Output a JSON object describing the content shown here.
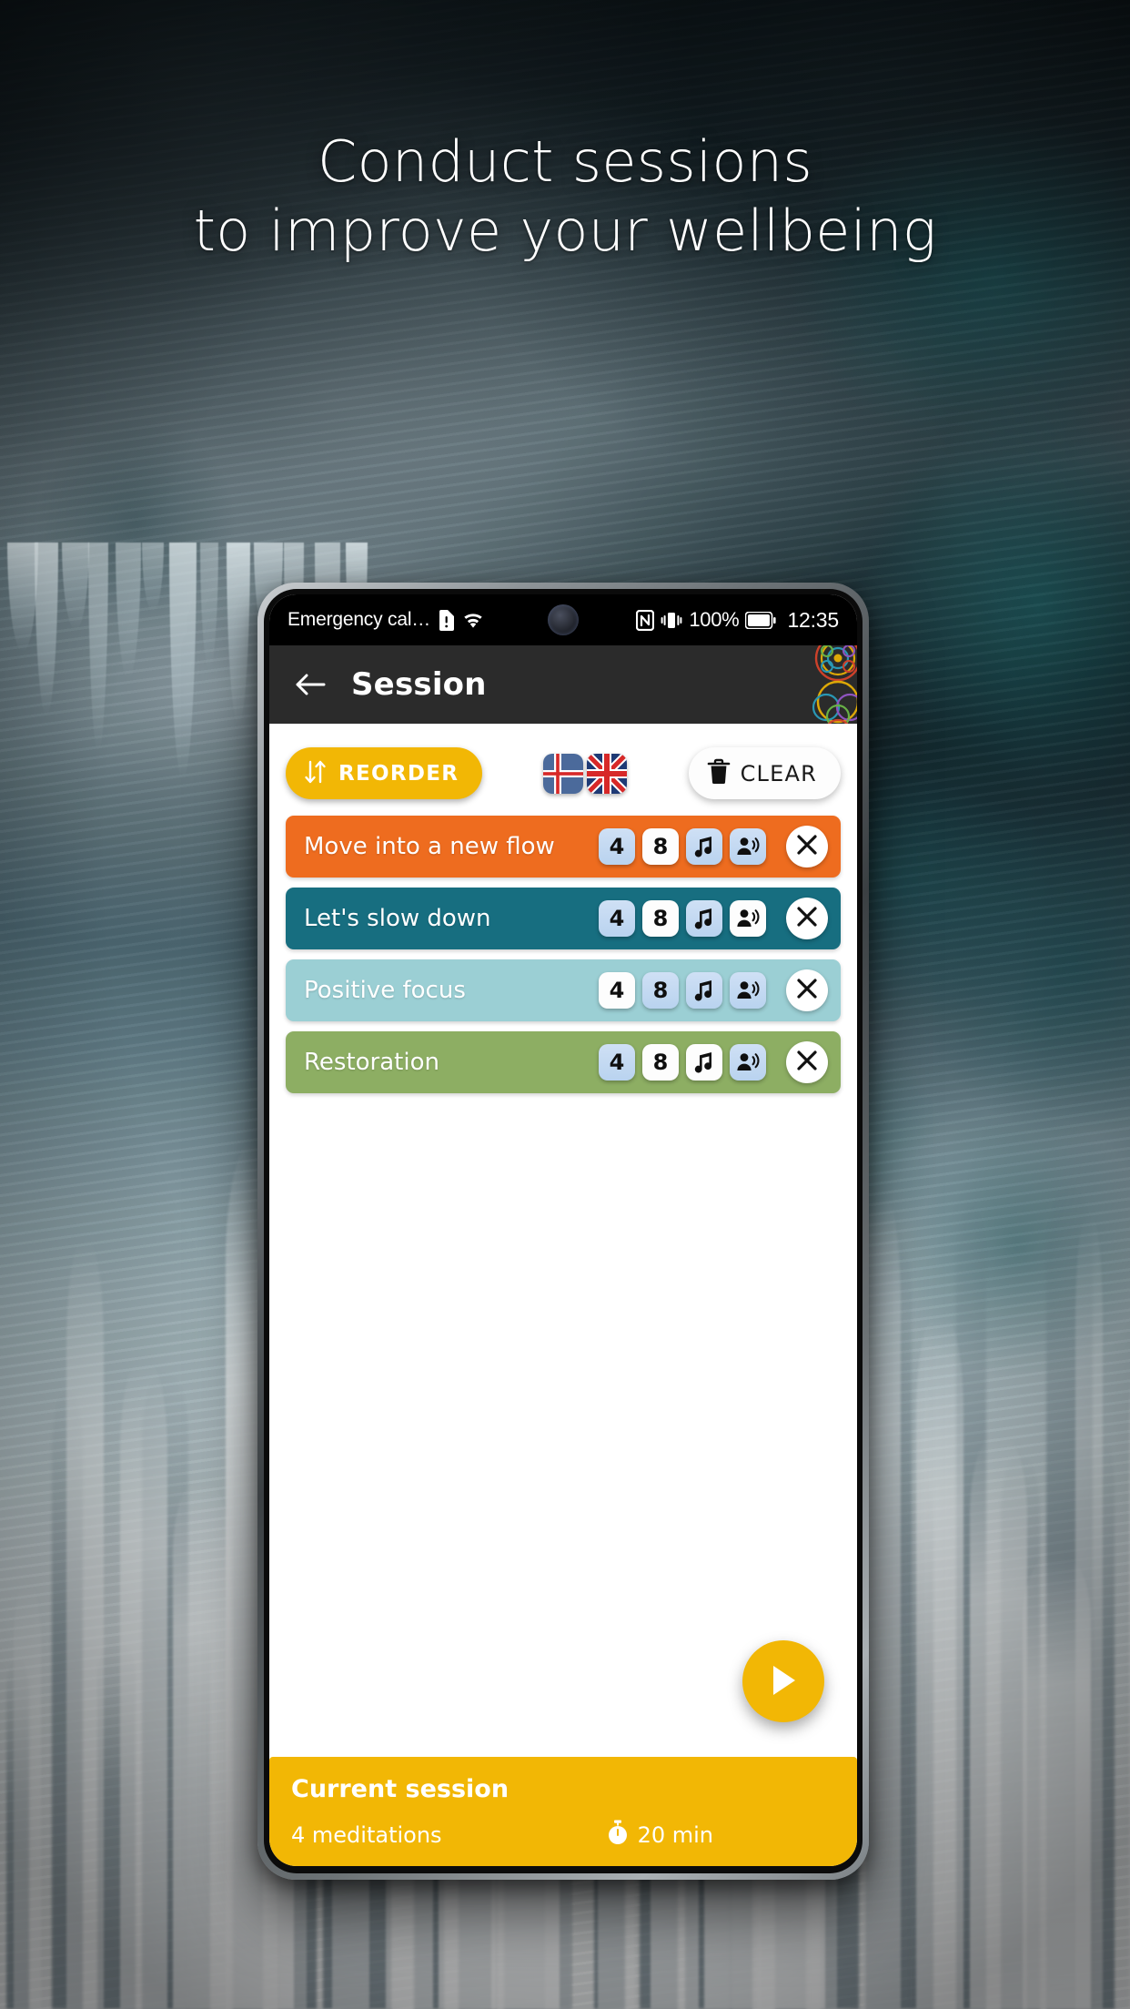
{
  "promo": {
    "headline_line1": "Conduct sessions",
    "headline_line2": "to improve your wellbeing"
  },
  "statusbar": {
    "carrier": "Emergency cal…",
    "sim_icon": "sim-alert-icon",
    "wifi_icon": "wifi-icon",
    "nfc_icon": "nfc-icon",
    "vibrate_icon": "vibrate-icon",
    "battery_percent": "100%",
    "battery_icon": "battery-full-icon",
    "clock": "12:35"
  },
  "appbar": {
    "back_icon": "back-arrow-icon",
    "title": "Session",
    "logo_icon": "mandala-logo-icon"
  },
  "toolbar": {
    "reorder_label": "REORDER",
    "reorder_icon": "sort-arrows-icon",
    "clear_label": "CLEAR",
    "clear_icon": "trash-icon",
    "flags": [
      {
        "name": "flag-iceland",
        "label": "Icelandic"
      },
      {
        "name": "flag-uk",
        "label": "English"
      }
    ]
  },
  "meditations": [
    {
      "title": "Move into a new flow",
      "color": "#EE6C1F",
      "badges": [
        {
          "name": "badge-4",
          "label": "4",
          "icon": "",
          "selected": true
        },
        {
          "name": "badge-8",
          "label": "8",
          "icon": "",
          "selected": false
        },
        {
          "name": "badge-music",
          "label": "",
          "icon": "music-note-icon",
          "selected": true
        },
        {
          "name": "badge-voice",
          "label": "",
          "icon": "voice-guide-icon",
          "selected": true
        }
      ],
      "close_icon": "close-icon"
    },
    {
      "title": "Let's slow down",
      "color": "#176E80",
      "badges": [
        {
          "name": "badge-4",
          "label": "4",
          "icon": "",
          "selected": true
        },
        {
          "name": "badge-8",
          "label": "8",
          "icon": "",
          "selected": false
        },
        {
          "name": "badge-music",
          "label": "",
          "icon": "music-note-icon",
          "selected": true
        },
        {
          "name": "badge-voice",
          "label": "",
          "icon": "voice-guide-icon",
          "selected": false
        }
      ],
      "close_icon": "close-icon"
    },
    {
      "title": "Positive focus",
      "color": "#9BCFD4",
      "badges": [
        {
          "name": "badge-4",
          "label": "4",
          "icon": "",
          "selected": false
        },
        {
          "name": "badge-8",
          "label": "8",
          "icon": "",
          "selected": true
        },
        {
          "name": "badge-music",
          "label": "",
          "icon": "music-note-icon",
          "selected": true
        },
        {
          "name": "badge-voice",
          "label": "",
          "icon": "voice-guide-icon",
          "selected": true
        }
      ],
      "close_icon": "close-icon"
    },
    {
      "title": "Restoration",
      "color": "#8DAE63",
      "badges": [
        {
          "name": "badge-4",
          "label": "4",
          "icon": "",
          "selected": true
        },
        {
          "name": "badge-8",
          "label": "8",
          "icon": "",
          "selected": false
        },
        {
          "name": "badge-music",
          "label": "",
          "icon": "music-note-icon",
          "selected": false
        },
        {
          "name": "badge-voice",
          "label": "",
          "icon": "voice-guide-icon",
          "selected": true
        }
      ],
      "close_icon": "close-icon"
    }
  ],
  "fab": {
    "icon": "play-icon"
  },
  "session": {
    "title": "Current session",
    "count": "4 meditations",
    "duration": "20 min",
    "duration_icon": "stopwatch-icon"
  },
  "colors": {
    "accent_yellow": "#F2B705",
    "appbar_dark": "#2B2B2B",
    "badge_selected": "#BFD6F0",
    "badge_unselected": "#FDFDFD"
  }
}
